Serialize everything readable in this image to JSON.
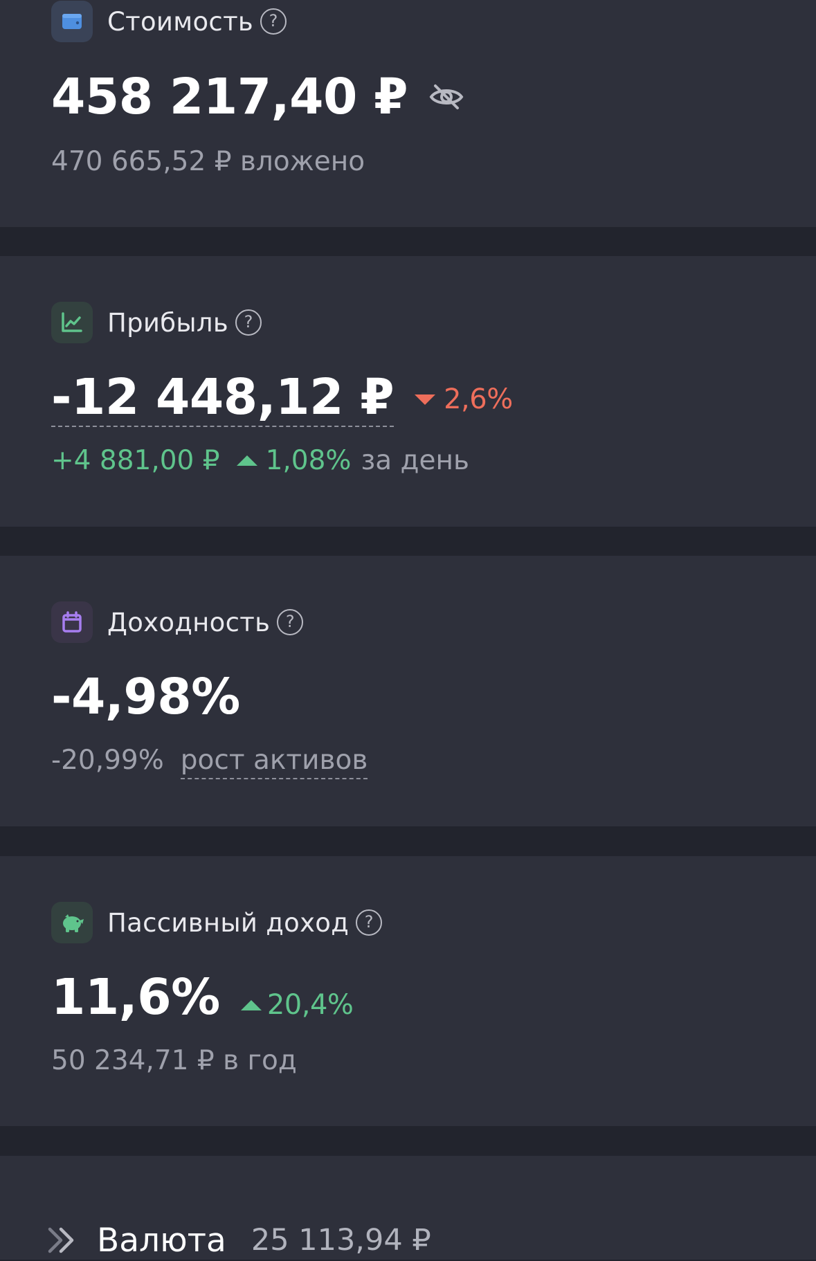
{
  "cost": {
    "title": "Стоимость",
    "help": "?",
    "value": "458 217,40 ₽",
    "invested": "470 665,52 ₽ вложено",
    "icon": "wallet-icon",
    "toggle_icon": "eye-off-icon"
  },
  "profit": {
    "title": "Прибыль",
    "help": "?",
    "value": "-12 448,12 ₽",
    "change_percent": "2,6%",
    "day_value": "+4 881,00 ₽",
    "day_percent": "1,08%",
    "day_label": "за день",
    "icon": "chart-icon"
  },
  "yield": {
    "title": "Доходность",
    "help": "?",
    "value": "-4,98%",
    "asset_growth_value": "-20,99%",
    "asset_growth_label": "рост активов",
    "icon": "calendar-icon"
  },
  "passive_income": {
    "title": "Пассивный доход",
    "help": "?",
    "value": "11,6%",
    "change_percent": "20,4%",
    "per_year": "50 234,71 ₽ в год",
    "icon": "piggy-bank-icon"
  },
  "currency": {
    "label": "Валюта",
    "value": "25 113,94 ₽",
    "icon": "chevron-double-right-icon"
  },
  "colors": {
    "background": "#22242d",
    "card": "#2e303b",
    "positive": "#5fc48c",
    "negative": "#ee6e5b",
    "muted": "#9fa1ac"
  }
}
